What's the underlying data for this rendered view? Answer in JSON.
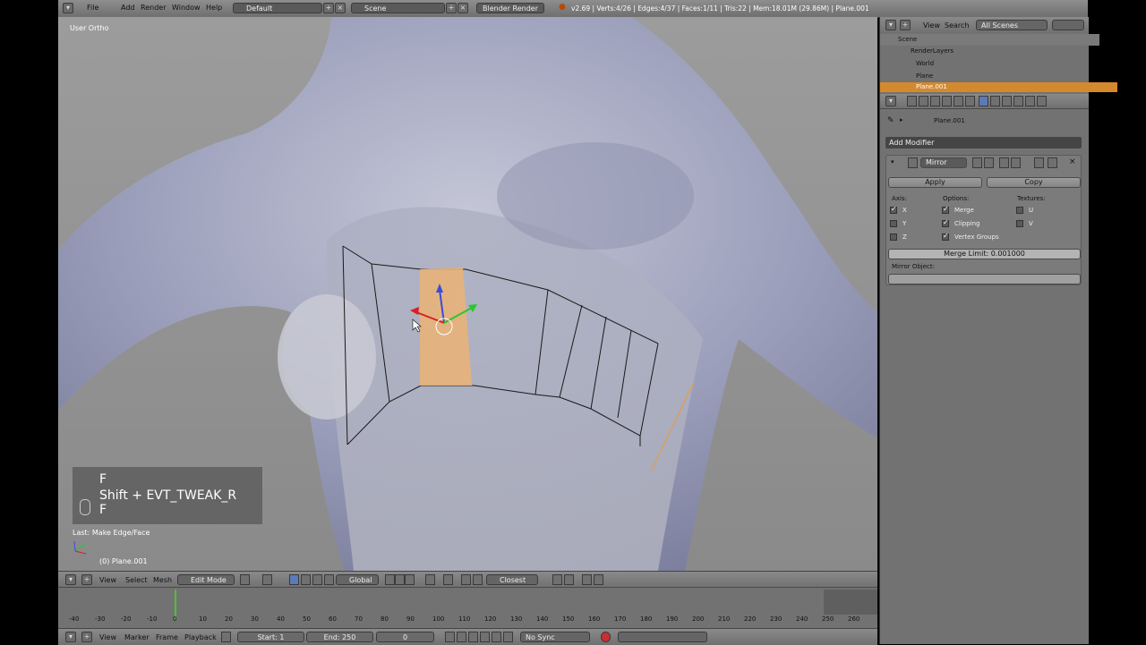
{
  "topbar": {
    "menu": [
      "File",
      "Add",
      "Render",
      "Window",
      "Help"
    ],
    "layout": "Default",
    "scene": "Scene",
    "engine": "Blender Render",
    "stats": "v2.69 | Verts:4/26 | Edges:4/37 | Faces:1/11 | Tris:22 | Mem:18.01M (29.86M) | Plane.001"
  },
  "viewport": {
    "view_label": "User Ortho",
    "key_lines": [
      "F",
      "Shift + EVT_TWEAK_R",
      "F"
    ],
    "last_op": "Last: Make Edge/Face",
    "object_name": "(0) Plane.001"
  },
  "view3d_header": {
    "menus": [
      "View",
      "Select",
      "Mesh"
    ],
    "mode": "Edit Mode",
    "orientation": "Global",
    "snap_target": "Closest"
  },
  "timeline": {
    "ticks": [
      "-40",
      "-30",
      "-20",
      "-10",
      "0",
      "10",
      "20",
      "30",
      "40",
      "50",
      "60",
      "70",
      "80",
      "90",
      "100",
      "110",
      "120",
      "130",
      "140",
      "150",
      "160",
      "170",
      "180",
      "190",
      "200",
      "210",
      "220",
      "230",
      "240",
      "250",
      "260"
    ],
    "menus": [
      "View",
      "Marker",
      "Frame",
      "Playback"
    ],
    "start": "Start: 1",
    "end": "End: 250",
    "current": "0",
    "sync": "No Sync"
  },
  "outliner": {
    "menus": [
      "View",
      "Search"
    ],
    "scene_filter": "All Scenes",
    "items": [
      "Scene",
      "RenderLayers",
      "World",
      "Plane",
      "Plane.001"
    ]
  },
  "properties": {
    "object": "Plane.001",
    "add_modifier": "Add Modifier",
    "modifier_name": "Mirror",
    "apply": "Apply",
    "copy": "Copy",
    "axis_label": "Axis:",
    "options_label": "Options:",
    "textures_label": "Textures:",
    "axes": [
      "X",
      "Y",
      "Z"
    ],
    "options": [
      "Merge",
      "Clipping",
      "Vertex Groups"
    ],
    "textures": [
      "U",
      "V"
    ],
    "merge_limit": "Merge Limit: 0.001000",
    "mirror_object_label": "Mirror Object:"
  },
  "colors": {
    "selected_face": "#e8b27a",
    "mesh_body": "#a9adc6",
    "frame_cursor": "#46c62a"
  }
}
